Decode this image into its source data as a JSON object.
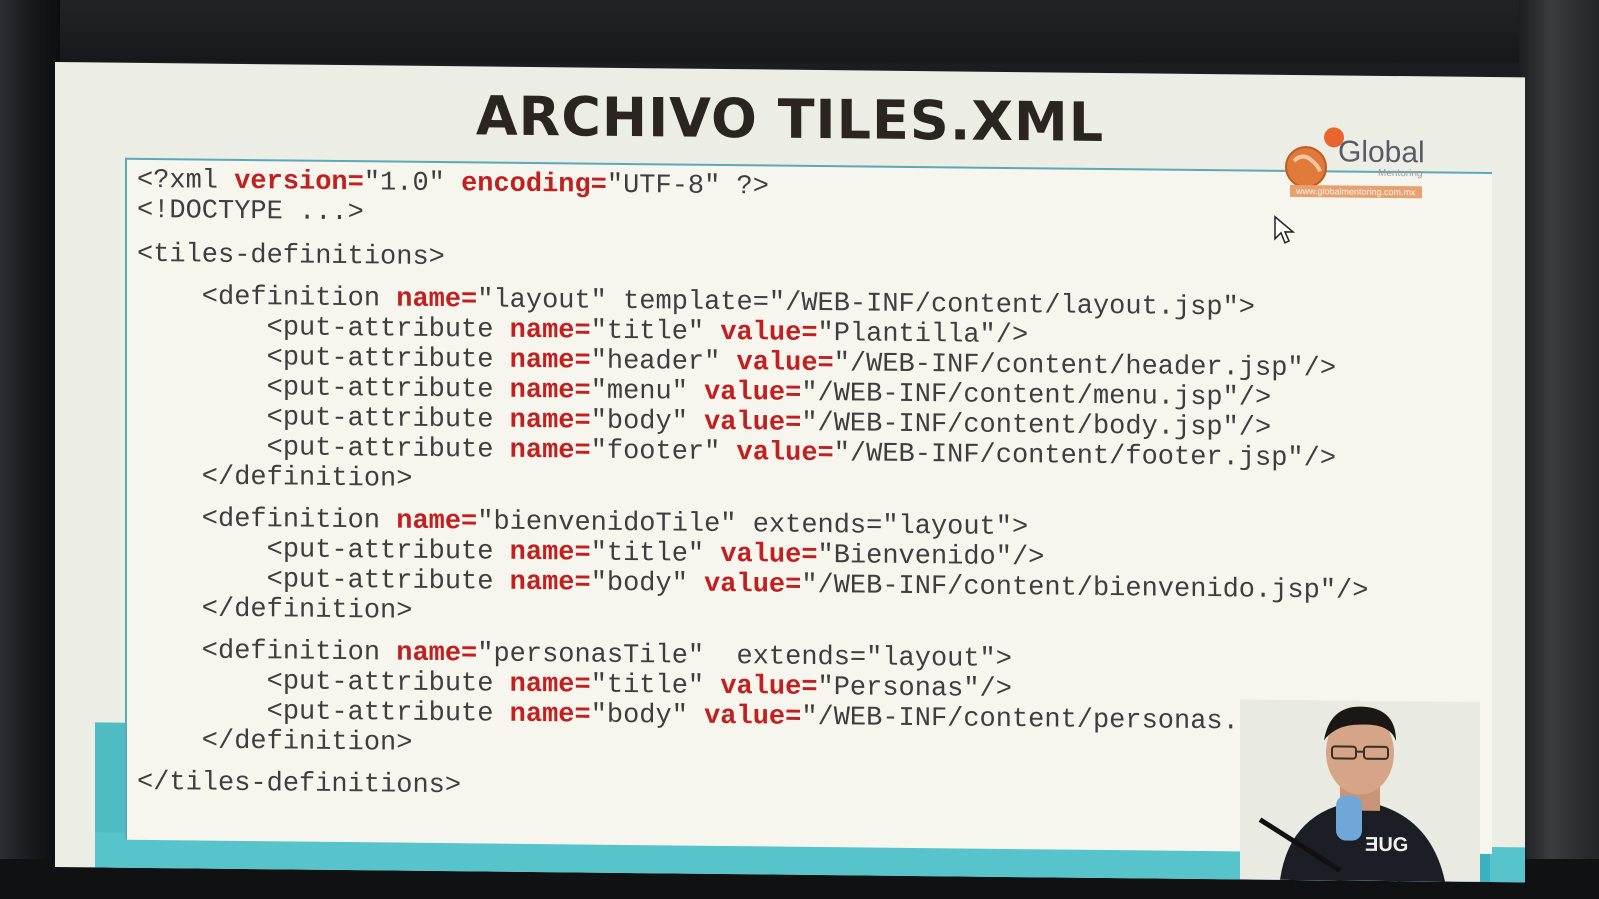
{
  "slide": {
    "title": "ARCHIVO TILES.XML",
    "logo_text": "Global",
    "logo_sub": "Mentoring",
    "logo_url": "www.globalmentoring.com.mx"
  },
  "code_lines": [
    {
      "id": "xml-decl",
      "parts": [
        [
          "t",
          "<?xml "
        ],
        [
          "k",
          "version="
        ],
        [
          "t",
          "\"1.0\" "
        ],
        [
          "k",
          "encoding="
        ],
        [
          "t",
          "\"UTF-8\" ?>"
        ]
      ]
    },
    {
      "id": "doctype",
      "parts": [
        [
          "t",
          "<!DOCTYPE ...>"
        ]
      ]
    },
    {
      "id": "tiles-open",
      "parts": [
        [
          "t",
          "<tiles-definitions>"
        ]
      ]
    },
    {
      "id": "def-layout-open",
      "parts": [
        [
          "t",
          "    <definition "
        ],
        [
          "k",
          "name="
        ],
        [
          "t",
          "\"layout\" template=\"/WEB-INF/content/layout.jsp\">"
        ]
      ]
    },
    {
      "id": "layout-title",
      "parts": [
        [
          "t",
          "        <put-attribute "
        ],
        [
          "k",
          "name="
        ],
        [
          "t",
          "\"title\" "
        ],
        [
          "k",
          "value="
        ],
        [
          "t",
          "\"Plantilla\"/>"
        ]
      ]
    },
    {
      "id": "layout-header",
      "parts": [
        [
          "t",
          "        <put-attribute "
        ],
        [
          "k",
          "name="
        ],
        [
          "t",
          "\"header\" "
        ],
        [
          "k",
          "value="
        ],
        [
          "t",
          "\"/WEB-INF/content/header.jsp\"/>"
        ]
      ]
    },
    {
      "id": "layout-menu",
      "parts": [
        [
          "t",
          "        <put-attribute "
        ],
        [
          "k",
          "name="
        ],
        [
          "t",
          "\"menu\" "
        ],
        [
          "k",
          "value="
        ],
        [
          "t",
          "\"/WEB-INF/content/menu.jsp\"/>"
        ]
      ]
    },
    {
      "id": "layout-body",
      "parts": [
        [
          "t",
          "        <put-attribute "
        ],
        [
          "k",
          "name="
        ],
        [
          "t",
          "\"body\" "
        ],
        [
          "k",
          "value="
        ],
        [
          "t",
          "\"/WEB-INF/content/body.jsp\"/>"
        ]
      ]
    },
    {
      "id": "layout-footer",
      "parts": [
        [
          "t",
          "        <put-attribute "
        ],
        [
          "k",
          "name="
        ],
        [
          "t",
          "\"footer\" "
        ],
        [
          "k",
          "value="
        ],
        [
          "t",
          "\"/WEB-INF/content/footer.jsp\"/>"
        ]
      ]
    },
    {
      "id": "def-layout-close",
      "parts": [
        [
          "t",
          "    </definition>"
        ]
      ]
    },
    {
      "id": "def-bienvenido-open",
      "parts": [
        [
          "t",
          "    <definition "
        ],
        [
          "k",
          "name="
        ],
        [
          "t",
          "\"bienvenidoTile\" extends=\"layout\">"
        ]
      ]
    },
    {
      "id": "bienvenido-title",
      "parts": [
        [
          "t",
          "        <put-attribute "
        ],
        [
          "k",
          "name="
        ],
        [
          "t",
          "\"title\" "
        ],
        [
          "k",
          "value="
        ],
        [
          "t",
          "\"Bienvenido\"/>"
        ]
      ]
    },
    {
      "id": "bienvenido-body",
      "parts": [
        [
          "t",
          "        <put-attribute "
        ],
        [
          "k",
          "name="
        ],
        [
          "t",
          "\"body\" "
        ],
        [
          "k",
          "value="
        ],
        [
          "t",
          "\"/WEB-INF/content/bienvenido.jsp\"/>"
        ]
      ]
    },
    {
      "id": "def-bienvenido-close",
      "parts": [
        [
          "t",
          "    </definition>"
        ]
      ]
    },
    {
      "id": "def-personas-open",
      "parts": [
        [
          "t",
          "    <definition "
        ],
        [
          "k",
          "name="
        ],
        [
          "t",
          "\"personasTile\"  extends=\"layout\">"
        ]
      ]
    },
    {
      "id": "personas-title",
      "parts": [
        [
          "t",
          "        <put-attribute "
        ],
        [
          "k",
          "name="
        ],
        [
          "t",
          "\"title\" "
        ],
        [
          "k",
          "value="
        ],
        [
          "t",
          "\"Personas\"/>"
        ]
      ]
    },
    {
      "id": "personas-body",
      "parts": [
        [
          "t",
          "        <put-attribute "
        ],
        [
          "k",
          "name="
        ],
        [
          "t",
          "\"body\" "
        ],
        [
          "k",
          "value="
        ],
        [
          "t",
          "\"/WEB-INF/content/personas.jsp"
        ]
      ]
    },
    {
      "id": "def-personas-close",
      "parts": [
        [
          "t",
          "    </definition>"
        ]
      ]
    },
    {
      "id": "tiles-close",
      "parts": [
        [
          "t",
          "</tiles-definitions>"
        ]
      ]
    }
  ],
  "colors": {
    "keyword": "#c21f1f",
    "text": "#3e3e3e",
    "accent": "#4fbcc4"
  }
}
